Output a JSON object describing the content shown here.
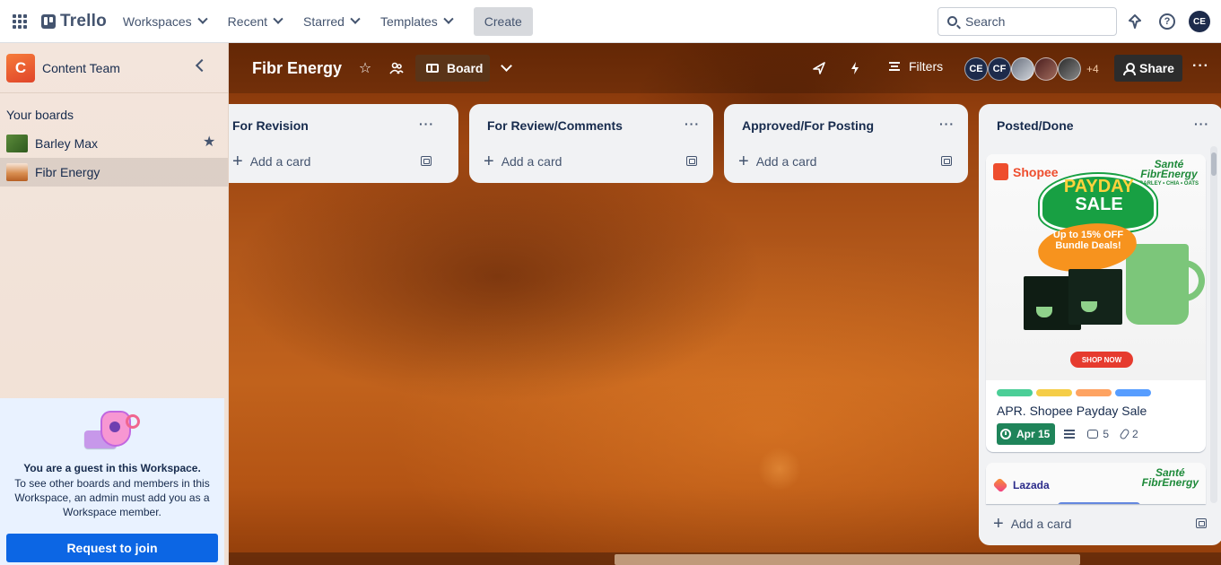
{
  "topbar": {
    "logo": "Trello",
    "nav": [
      "Workspaces",
      "Recent",
      "Starred",
      "Templates"
    ],
    "create_label": "Create",
    "search_placeholder": "Search",
    "user_initials": "CE"
  },
  "sidebar": {
    "workspace_initial": "C",
    "workspace_name": "Content Team",
    "your_boards_label": "Your boards",
    "boards": [
      {
        "name": "Barley Max",
        "starred": true
      },
      {
        "name": "Fibr Energy",
        "active": true
      }
    ],
    "guest": {
      "title": "You are a guest in this Workspace.",
      "description": "To see other boards and members in this Workspace, an admin must add you as a Workspace member.",
      "button": "Request to join"
    }
  },
  "board": {
    "title": "Fibr Energy",
    "view_label": "Board",
    "filters_label": "Filters",
    "members": [
      "CE",
      "CF"
    ],
    "more_members": "+4",
    "share_label": "Share",
    "add_card_label": "Add a card",
    "lists": [
      {
        "title": "For Revision"
      },
      {
        "title": "For Review/Comments"
      },
      {
        "title": "Approved/For Posting"
      },
      {
        "title": "Posted/Done"
      }
    ],
    "cards": [
      {
        "title": "APR. Shopee Payday Sale",
        "labels": [
          "#4bce97",
          "#f5cd47",
          "#fea362",
          "#579dff"
        ],
        "due": "Apr 15",
        "comments": "5",
        "attachments": "2",
        "cover": {
          "shop": "Shopee",
          "brand": "Santé",
          "brand_name": "FibrEnergy",
          "brand_tagline": "BARLEY • CHIA • OATS",
          "headline_1": "PAYDAY",
          "headline_2": "SALE",
          "offer": "Up to 15% OFF Bundle Deals!",
          "cta": "SHOP NOW"
        }
      },
      {
        "cover": {
          "shop": "Lazada",
          "brand": "Santé",
          "brand_name": "FibrEnergy"
        }
      }
    ]
  }
}
